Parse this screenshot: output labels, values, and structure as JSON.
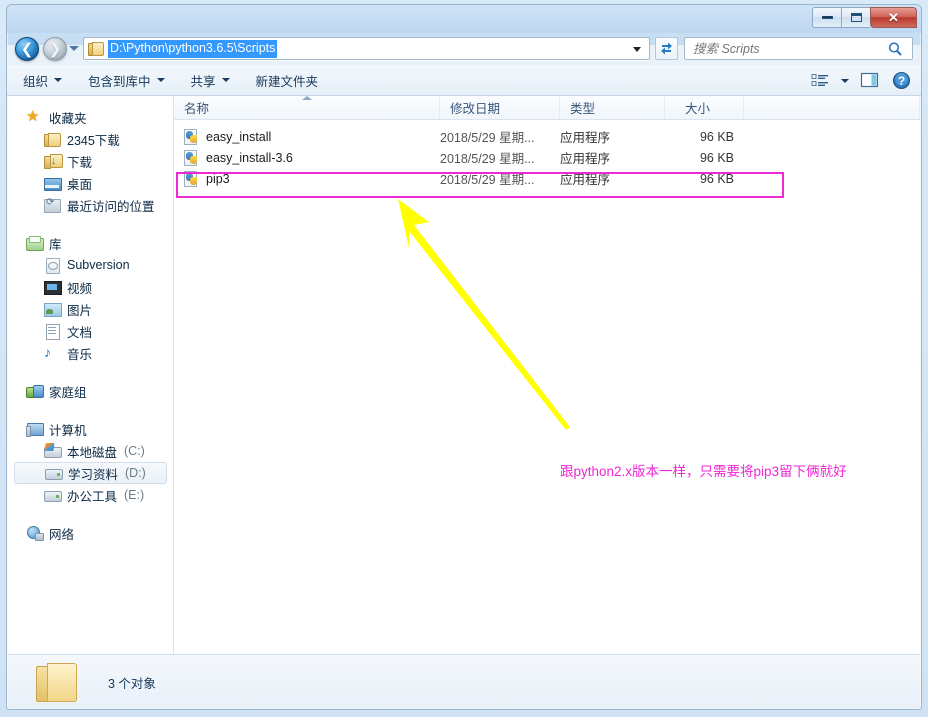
{
  "window": {
    "titlebar_title": "",
    "controls": {
      "minimize": "最小化",
      "maximize": "最大化",
      "close": "关闭",
      "close_glyph": "✕"
    }
  },
  "navigation": {
    "back_label": "后退",
    "forward_label": "前进",
    "history_label": "最近浏览的位置",
    "address_value": "D:\\Python\\python3.6.5\\Scripts",
    "refresh_label": "刷新"
  },
  "search": {
    "placeholder": "搜索 Scripts",
    "value": ""
  },
  "toolbar": {
    "items": [
      {
        "label": "组织",
        "has_caret": true
      },
      {
        "label": "包含到库中",
        "has_caret": true
      },
      {
        "label": "共享",
        "has_caret": true
      },
      {
        "label": "新建文件夹",
        "has_caret": false
      }
    ],
    "view_label": "更改您的视图",
    "preview_label": "显示预览窗格",
    "help_label": "获取帮助"
  },
  "sidebar": {
    "groups": [
      {
        "head": {
          "label": "收藏夹",
          "icon": "star-icon"
        },
        "items": [
          {
            "label": "2345下载",
            "icon": "folder-icon",
            "selected": false
          },
          {
            "label": "下载",
            "icon": "downloads-folder-icon",
            "selected": false
          },
          {
            "label": "桌面",
            "icon": "desktop-icon",
            "selected": false
          },
          {
            "label": "最近访问的位置",
            "icon": "recent-places-icon",
            "selected": false
          }
        ]
      },
      {
        "head": {
          "label": "库",
          "icon": "library-icon"
        },
        "items": [
          {
            "label": "Subversion",
            "icon": "subversion-icon",
            "selected": false
          },
          {
            "label": "视频",
            "icon": "video-icon",
            "selected": false
          },
          {
            "label": "图片",
            "icon": "pictures-icon",
            "selected": false
          },
          {
            "label": "文档",
            "icon": "documents-icon",
            "selected": false
          },
          {
            "label": "音乐",
            "icon": "music-icon",
            "selected": false
          }
        ]
      },
      {
        "head": {
          "label": "家庭组",
          "icon": "homegroup-icon"
        },
        "items": []
      },
      {
        "head": {
          "label": "计算机",
          "icon": "computer-icon"
        },
        "items": [
          {
            "label": "本地磁盘",
            "drive": "(C:)",
            "icon": "system-drive-icon",
            "selected": false
          },
          {
            "label": "学习资料",
            "drive": "(D:)",
            "icon": "drive-icon",
            "selected": true
          },
          {
            "label": "办公工具",
            "drive": "(E:)",
            "icon": "drive-icon",
            "selected": false
          }
        ]
      },
      {
        "head": {
          "label": "网络",
          "icon": "network-icon"
        },
        "items": []
      }
    ]
  },
  "filelist": {
    "columns": [
      {
        "key": "name",
        "label": "名称",
        "sorted": true,
        "sort_dir": "asc"
      },
      {
        "key": "date",
        "label": "修改日期",
        "sorted": false
      },
      {
        "key": "type",
        "label": "类型",
        "sorted": false
      },
      {
        "key": "size",
        "label": "大小",
        "sorted": false
      }
    ],
    "rows": [
      {
        "name": "easy_install",
        "date": "2018/5/29 星期...",
        "type": "应用程序",
        "size": "96 KB",
        "icon": "python-exe-icon",
        "highlighted": false
      },
      {
        "name": "easy_install-3.6",
        "date": "2018/5/29 星期...",
        "type": "应用程序",
        "size": "96 KB",
        "icon": "python-exe-icon",
        "highlighted": false
      },
      {
        "name": "pip3",
        "date": "2018/5/29 星期...",
        "type": "应用程序",
        "size": "96 KB",
        "icon": "python-exe-icon",
        "highlighted": true
      }
    ]
  },
  "statusbar": {
    "count_text": "3 个对象",
    "icon": "folder-icon"
  },
  "annotations": {
    "note_text": "跟python2.x版本一样，只需要将pip3留下俩就好",
    "note_color": "#ef27d4",
    "arrow_color": "#ffff00",
    "highlight_color": "#ef27d4"
  }
}
